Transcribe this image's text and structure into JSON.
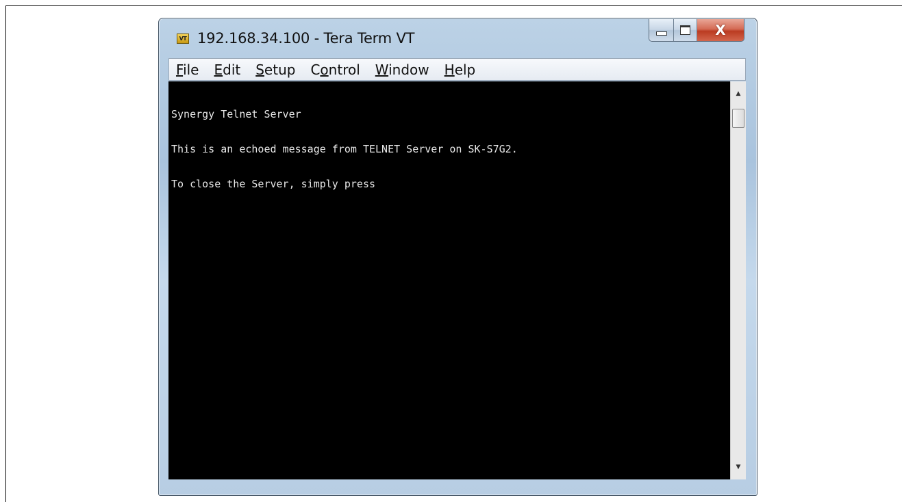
{
  "window": {
    "title": "192.168.34.100 - Tera Term VT",
    "app_icon": "VT",
    "close_glyph": "X"
  },
  "menu": [
    {
      "mnemonic": "F",
      "rest": "ile"
    },
    {
      "mnemonic": "E",
      "rest": "dit"
    },
    {
      "mnemonic": "S",
      "rest": "etup"
    },
    {
      "pre": "C",
      "mnemonic": "o",
      "rest": "ntrol"
    },
    {
      "mnemonic": "W",
      "rest": "indow"
    },
    {
      "mnemonic": "H",
      "rest": "elp"
    }
  ],
  "terminal": {
    "lines": [
      "Synergy Telnet Server",
      "This is an echoed message from TELNET Server on SK-S7G2.",
      "To close the Server, simply press"
    ],
    "background": "#000000",
    "foreground": "#e8e8e8"
  },
  "scrollbar": {
    "up_icon": "scroll-up-arrow-icon",
    "down_icon": "scroll-down-arrow-icon"
  }
}
